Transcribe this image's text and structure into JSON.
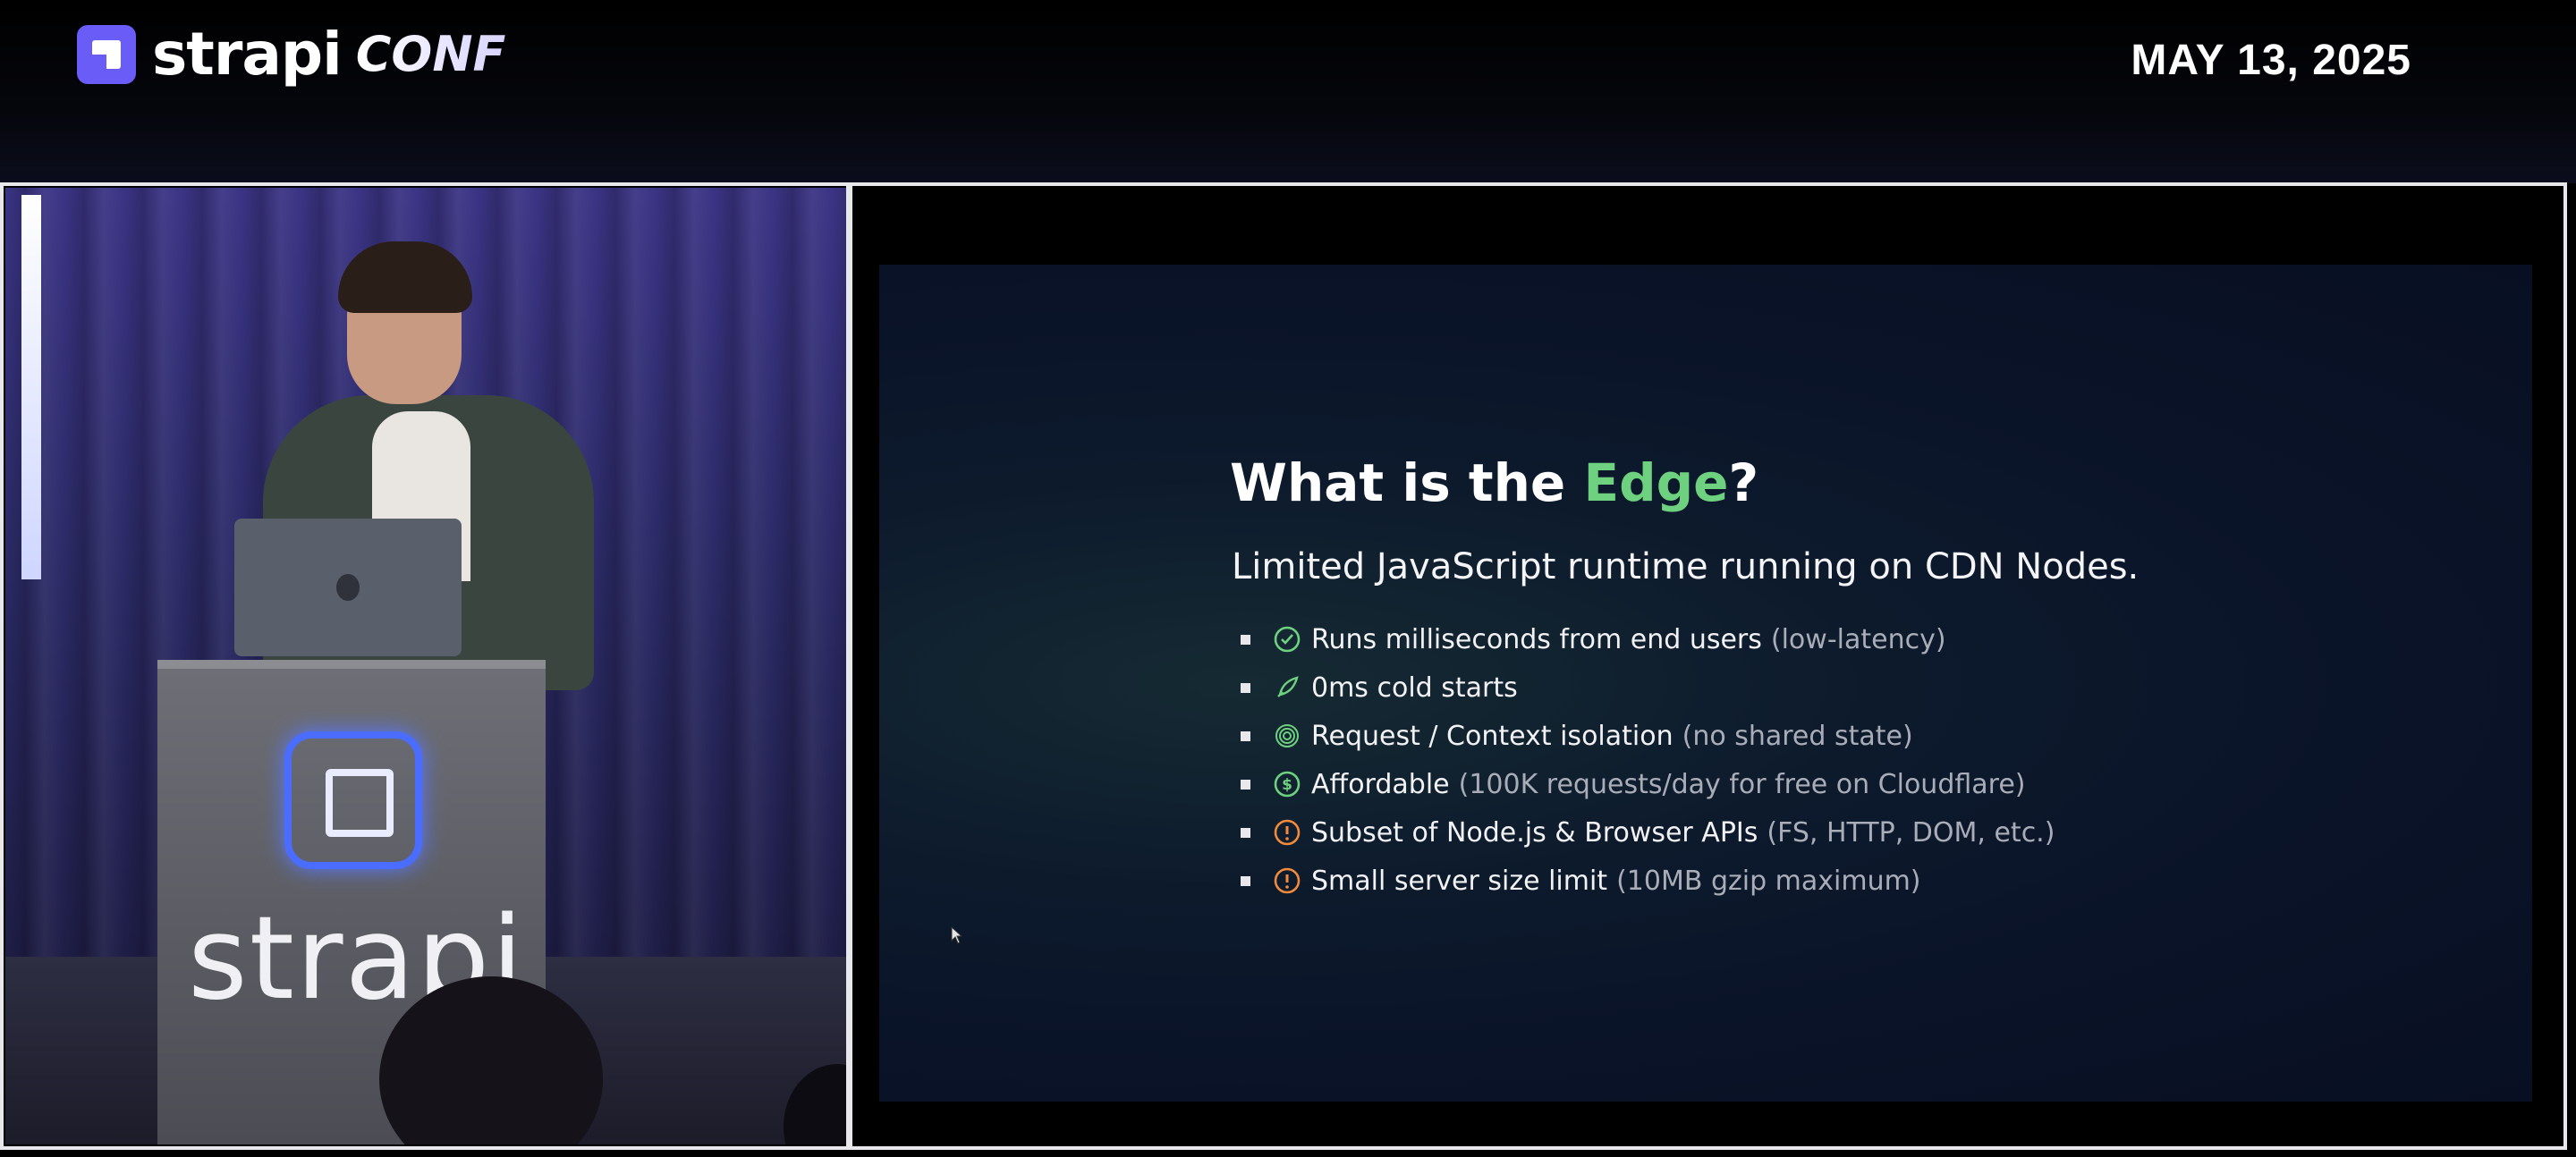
{
  "header": {
    "logo_word": "strapi",
    "logo_conf": "CONF",
    "date": "MAY 13, 2025"
  },
  "speaker_panel": {
    "podium_word": "strapi"
  },
  "slide": {
    "title_pre": "What is the ",
    "title_accent": "Edge",
    "title_post": "?",
    "subtitle": "Limited JavaScript runtime running on CDN Nodes.",
    "bullets": [
      {
        "text": "Runs milliseconds from end users",
        "note": "(low-latency)",
        "icon": "check-circle-icon",
        "icon_color": "#6ed17f"
      },
      {
        "text": "0ms cold starts",
        "note": "",
        "icon": "rocket-icon",
        "icon_color": "#6ed17f"
      },
      {
        "text": "Request / Context isolation",
        "note": "(no shared state)",
        "icon": "fingerprint-icon",
        "icon_color": "#6ed17f"
      },
      {
        "text": "Affordable",
        "note": "(100K requests/day for free on Cloudflare)",
        "icon": "dollar-circle-icon",
        "icon_color": "#6ed17f"
      },
      {
        "text": "Subset of Node.js & Browser APIs",
        "note": "(FS, HTTP, DOM, etc.)",
        "icon": "warning-circle-icon",
        "icon_color": "#f08a3c"
      },
      {
        "text": "Small server size limit",
        "note": "(10MB gzip maximum)",
        "icon": "warning-circle-icon",
        "icon_color": "#f08a3c"
      }
    ]
  },
  "colors": {
    "accent_green": "#6ed17f",
    "warning_orange": "#f08a3c",
    "brand_purple": "#6a5cf6",
    "frame_border": "#e8e8ec"
  }
}
